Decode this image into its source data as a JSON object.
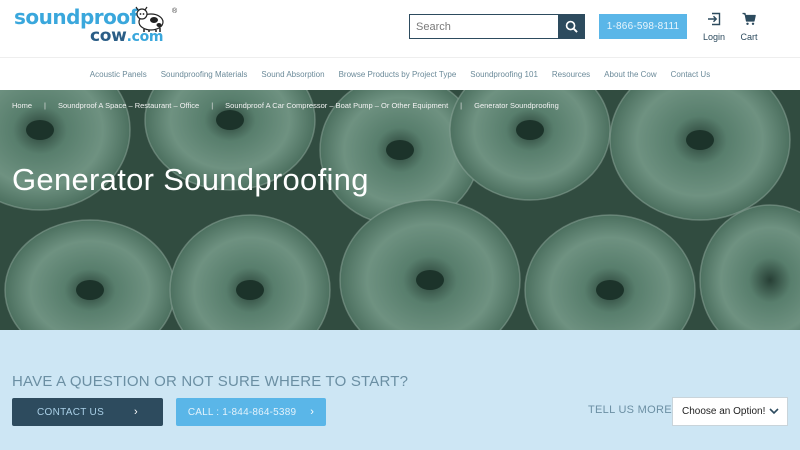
{
  "brand": {
    "logo_line1": "soundproof",
    "logo_line2": "cow",
    "logo_suffix": ".com",
    "registered": "®",
    "colors": {
      "primary_dark": "#2d4b5e",
      "accent_blue": "#5ab6e8",
      "logo_blue": "#3aa7dc",
      "cta_bg": "#cde6f4"
    }
  },
  "header": {
    "search_placeholder": "Search",
    "search_icon": "search-icon",
    "phone": "1-866-598-8111",
    "login_label": "Login",
    "login_icon": "login-icon",
    "cart_label": "Cart",
    "cart_icon": "cart-icon"
  },
  "nav": {
    "items": [
      "Acoustic Panels",
      "Soundproofing Materials",
      "Sound Absorption",
      "Browse Products by Project Type",
      "Soundproofing 101",
      "Resources",
      "About the Cow",
      "Contact Us"
    ]
  },
  "breadcrumb": {
    "items": [
      "Home",
      "Soundproof A Space – Restaurant – Office",
      "Soundproof A Car Compressor – Boat Pump – Or Other Equipment",
      "Generator Soundproofing"
    ],
    "separator": "|"
  },
  "hero": {
    "title": "Generator Soundproofing"
  },
  "cta": {
    "heading": "HAVE A QUESTION OR NOT SURE WHERE TO START?",
    "contact_label": "CONTACT US",
    "call_label": "CALL : 1-844-864-5389",
    "chevron": "›",
    "tell_us_label": "TELL US MORE",
    "select_value": "Choose an Option!"
  }
}
